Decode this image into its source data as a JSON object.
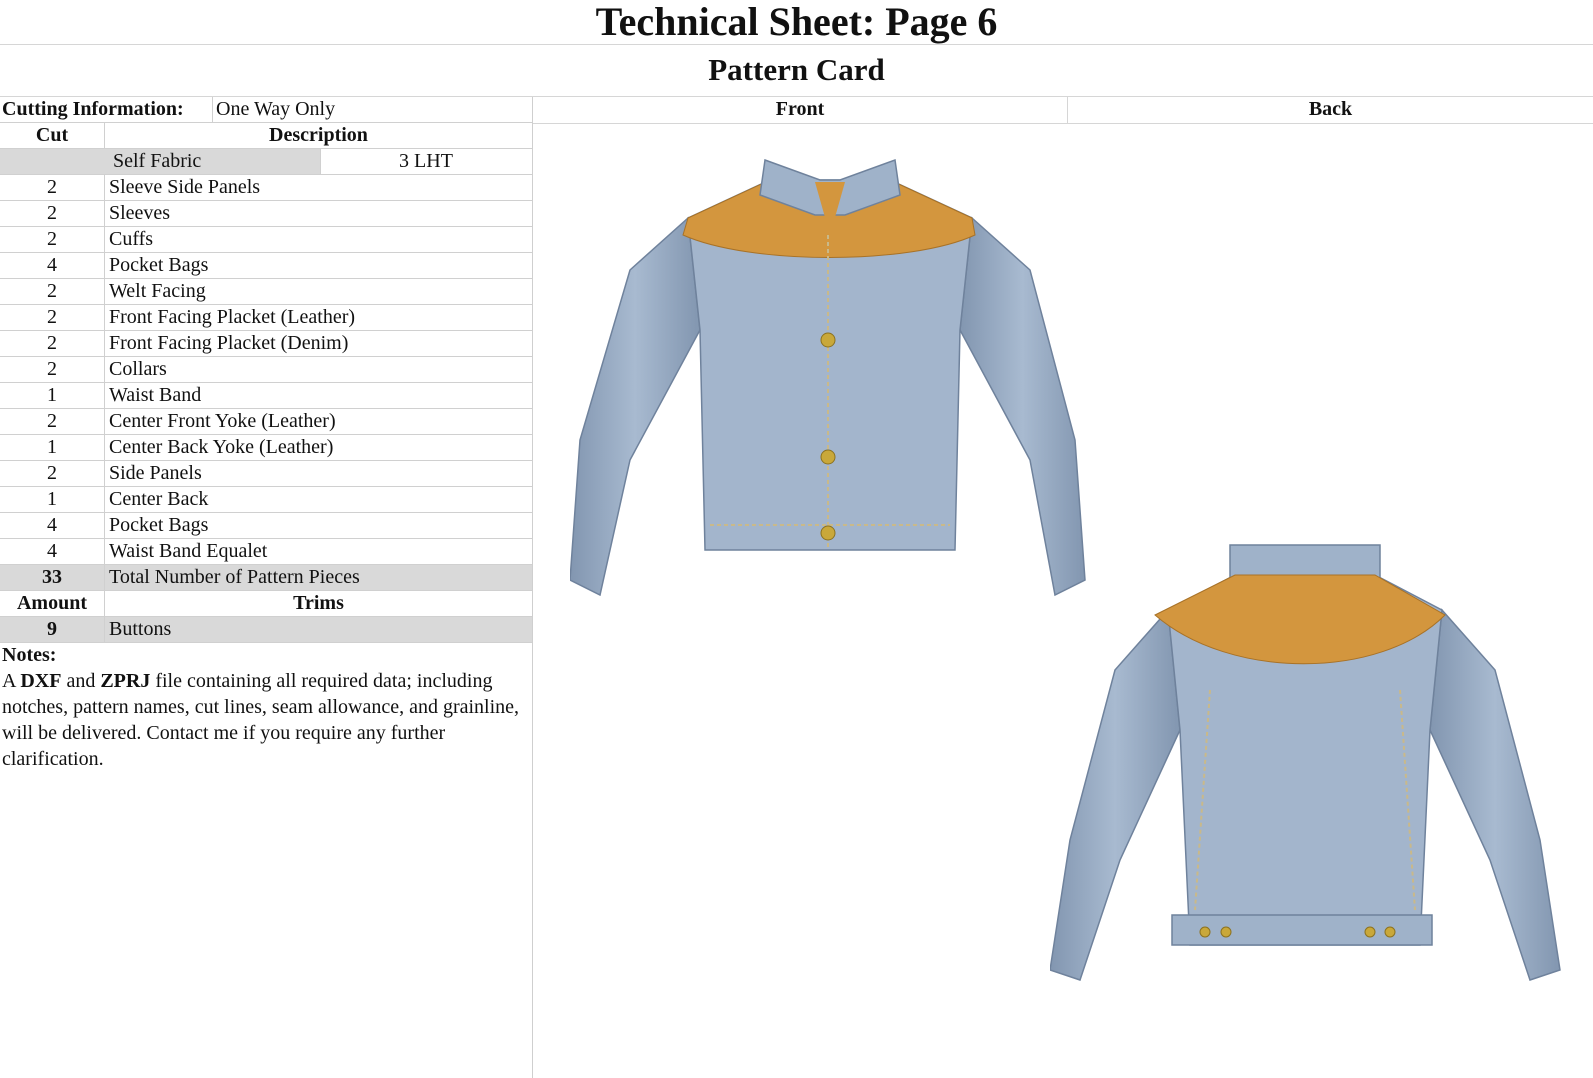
{
  "header": {
    "title": "Technical Sheet: Page 6",
    "subtitle": "Pattern Card"
  },
  "cutting": {
    "label": "Cutting Information:",
    "value": "One Way Only"
  },
  "table": {
    "col_cut": "Cut",
    "col_description": "Description",
    "fabric_label": "Self Fabric",
    "fabric_value": "3 LHT",
    "rows": [
      {
        "cut": "2",
        "desc": "Sleeve Side Panels"
      },
      {
        "cut": "2",
        "desc": "Sleeves"
      },
      {
        "cut": "2",
        "desc": "Cuffs"
      },
      {
        "cut": "4",
        "desc": "Pocket Bags"
      },
      {
        "cut": "2",
        "desc": "Welt Facing"
      },
      {
        "cut": "2",
        "desc": "Front Facing Placket (Leather)"
      },
      {
        "cut": "2",
        "desc": "Front Facing Placket (Denim)"
      },
      {
        "cut": "2",
        "desc": "Collars"
      },
      {
        "cut": "1",
        "desc": "Waist Band"
      },
      {
        "cut": "2",
        "desc": "Center Front Yoke (Leather)"
      },
      {
        "cut": "1",
        "desc": "Center Back Yoke (Leather)"
      },
      {
        "cut": "2",
        "desc": "Side Panels"
      },
      {
        "cut": "1",
        "desc": "Center Back"
      },
      {
        "cut": "4",
        "desc": "Pocket Bags"
      },
      {
        "cut": "4",
        "desc": "Waist Band Equalet"
      }
    ],
    "total_cut": "33",
    "total_label": "Total Number of Pattern Pieces"
  },
  "trims": {
    "col_amount": "Amount",
    "col_trims": "Trims",
    "amount": "9",
    "item": "Buttons"
  },
  "notes": {
    "title": "Notes:",
    "pre": "A ",
    "bold1": "DXF",
    "mid1": " and ",
    "bold2": "ZPRJ",
    "rest": " file containing all required data; including notches, pattern names, cut lines, seam allowance, and grainline, will be delivered. Contact me if you require any further clarification."
  },
  "views": {
    "front_label": "Front",
    "back_label": "Back"
  },
  "colors": {
    "denim": "#9aaec6",
    "yoke": "#d3963e",
    "button": "#c9a83a",
    "row_shade": "#d9d9d9"
  }
}
